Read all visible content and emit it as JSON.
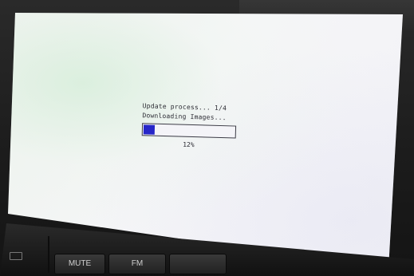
{
  "dialog": {
    "title": "Update process... 1/4",
    "message": "Downloading Images...",
    "progress_fraction": 0.12,
    "progress_label": "12%",
    "progress_color": "#2626c8"
  },
  "console": {
    "mute_label": "MUTE",
    "fm_label": "FM"
  }
}
